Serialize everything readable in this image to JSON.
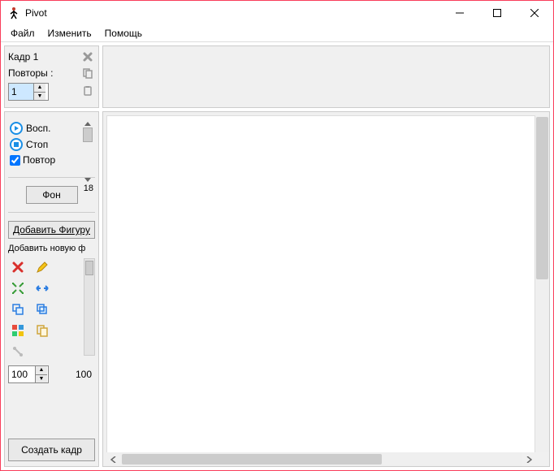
{
  "window": {
    "title": "Pivot"
  },
  "menu": {
    "file": "Файл",
    "edit": "Изменить",
    "help": "Помощь"
  },
  "frame_panel": {
    "frame_label": "Кадр 1",
    "repeats_label": "Повторы :",
    "repeats_value": "1"
  },
  "playback": {
    "play_label": "Восп.",
    "stop_label": "Стоп",
    "loop_label": "Повтор",
    "loop_checked": true,
    "speed_value": "18"
  },
  "buttons": {
    "background": "Фон",
    "add_figure": "Добавить Фигуру",
    "add_new_label": "Добавить новую ф",
    "create_frame": "Создать кадр"
  },
  "scale": {
    "input_value": "100",
    "display_value": "100"
  },
  "tool_icons": {
    "delete": "delete-icon",
    "edit": "pencil-icon",
    "center": "center-icon",
    "flip": "flip-horizontal-icon",
    "duplicate": "duplicate-icon",
    "front": "bring-front-icon",
    "color": "color-grid-icon",
    "copy": "copy-icon",
    "join": "join-icon"
  }
}
